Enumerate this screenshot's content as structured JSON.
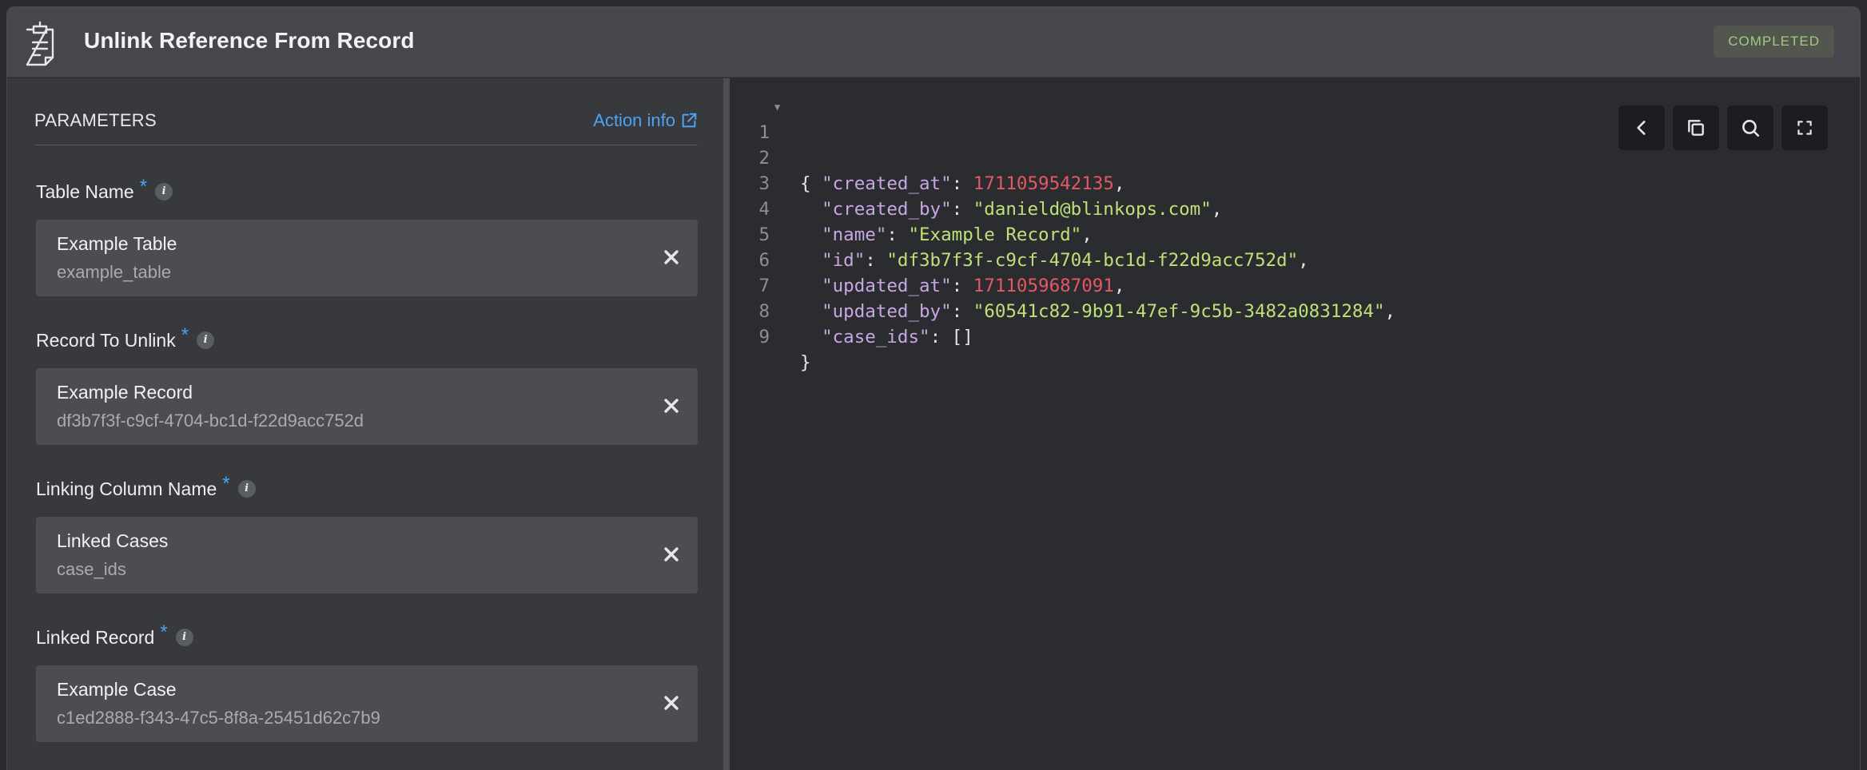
{
  "header": {
    "title": "Unlink Reference From Record",
    "status": "COMPLETED",
    "icon": "clipboard-icon"
  },
  "parameters": {
    "title": "PARAMETERS",
    "action_info": "Action info",
    "required_mark": "*",
    "info_glyph": "i",
    "fields": [
      {
        "label": "Table Name",
        "value": "Example Table",
        "sub": "example_table"
      },
      {
        "label": "Record To Unlink",
        "value": "Example Record",
        "sub": "df3b7f3f-c9cf-4704-bc1d-f22d9acc752d"
      },
      {
        "label": "Linking Column Name",
        "value": "Linked Cases",
        "sub": "case_ids"
      },
      {
        "label": "Linked Record",
        "value": "Example Case",
        "sub": "c1ed2888-f343-47c5-8f8a-25451d62c7b9"
      }
    ]
  },
  "json_view": {
    "fold_glyph": "▼",
    "open_brace": "{",
    "close_brace": "}",
    "entries": [
      {
        "key": "\"created_at\"",
        "value": "1711059542135",
        "type": "number"
      },
      {
        "key": "\"created_by\"",
        "value": "\"danield@blinkops.com\"",
        "type": "string"
      },
      {
        "key": "\"name\"",
        "value": "\"Example Record\"",
        "type": "string"
      },
      {
        "key": "\"id\"",
        "value": "\"df3b7f3f-c9cf-4704-bc1d-f22d9acc752d\"",
        "type": "string"
      },
      {
        "key": "\"updated_at\"",
        "value": "1711059687091",
        "type": "number"
      },
      {
        "key": "\"updated_by\"",
        "value": "\"60541c82-9b91-47ef-9c5b-3482a0831284\"",
        "type": "string"
      },
      {
        "key": "\"case_ids\"",
        "value": "[]",
        "type": "plain"
      }
    ],
    "line_numbers": [
      "1",
      "2",
      "3",
      "4",
      "5",
      "6",
      "7",
      "8",
      "9"
    ]
  },
  "toolbar": {
    "buttons": [
      "chevron-left-icon",
      "copy-icon",
      "search-icon",
      "fullscreen-icon"
    ]
  },
  "colors": {
    "accent": "#4aa3f5",
    "status": "#9ccb84",
    "json_key": "#c9a6e3",
    "json_string": "#bde077",
    "json_number": "#e45864"
  }
}
